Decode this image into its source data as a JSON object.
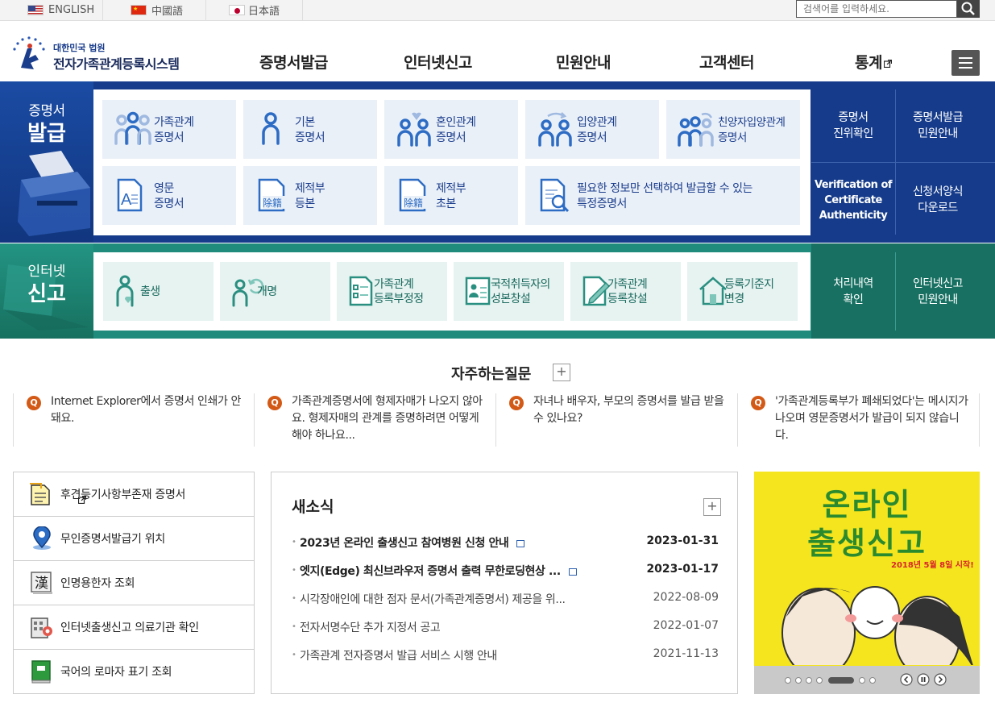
{
  "lang_bar": {
    "english": "ENGLISH",
    "chinese": "中國語",
    "japanese": "日本語",
    "search_placeholder": "검색어를 입력하세요."
  },
  "header": {
    "logo_line1": "대한민국 법원",
    "logo_line2": "전자가족관계등록시스템",
    "nav": [
      "증명서발급",
      "인터넷신고",
      "민원안내",
      "고객센터",
      "통계"
    ]
  },
  "issuance": {
    "section_small": "증명서",
    "section_big": "발급",
    "cards": [
      {
        "l1": "가족관계",
        "l2": "증명서"
      },
      {
        "l1": "기본",
        "l2": "증명서"
      },
      {
        "l1": "혼인관계",
        "l2": "증명서"
      },
      {
        "l1": "입양관계",
        "l2": "증명서"
      },
      {
        "l1": "친양자입양관계",
        "l2": "증명서"
      },
      {
        "l1": "영문",
        "l2": "증명서"
      },
      {
        "l1": "제적부",
        "l2": "등본"
      },
      {
        "l1": "제적부",
        "l2": "초본"
      },
      {
        "l1": "필요한 정보만 선택하여 발급할 수 있는",
        "l2": "특정증명서"
      }
    ],
    "icon_text_a": "A",
    "icon_text_jejeok": "除籍",
    "side_links": [
      {
        "l1": "증명서",
        "l2": "진위확인"
      },
      {
        "l1": "증명서발급",
        "l2": "민원안내"
      },
      {
        "l1": "Verification of",
        "l2": "Certificate",
        "l3": "Authenticity"
      },
      {
        "l1": "신청서양식",
        "l2": "다운로드"
      }
    ]
  },
  "report": {
    "section_small": "인터넷",
    "section_big": "신고",
    "cards": [
      {
        "l1": "출생",
        "l2": ""
      },
      {
        "l1": "개명",
        "l2": ""
      },
      {
        "l1": "가족관계",
        "l2": "등록부정정"
      },
      {
        "l1": "국적취득자의",
        "l2": "성본창설"
      },
      {
        "l1": "가족관계",
        "l2": "등록창설"
      },
      {
        "l1": "등록기준지",
        "l2": "변경"
      }
    ],
    "side_links": [
      {
        "l1": "처리내역",
        "l2": "확인"
      },
      {
        "l1": "인터넷신고",
        "l2": "민원안내"
      }
    ]
  },
  "faq": {
    "title": "자주하는질문",
    "more": "+",
    "q_mark": "Q",
    "items": [
      "Internet Explorer에서 증명서 인쇄가 안돼요.",
      "가족관계증명서에 형제자매가 나오지 않아요. 형제자매의 관계를 증명하려면 어떻게 해야 하나요...",
      "자녀나 배우자, 부모의 증명서를 발급 받을 수 있나요?",
      "'가족관계등록부가 폐쇄되었다'는 메시지가 나오며 영문증명서가 발급이 되지 않습니다."
    ]
  },
  "quick_links": [
    "후견등기사항부존재 증명서",
    "무인증명서발급기 위치",
    "인명용한자 조회",
    "인터넷출생신고 의료기관 확인",
    "국어의 로마자 표기 조회"
  ],
  "quick_icon_text": "漢",
  "news": {
    "title": "새소식",
    "more": "+",
    "items": [
      {
        "title": "2023년 온라인 출생신고 참여병원 신청 안내",
        "date": "2023-01-31",
        "bold": true
      },
      {
        "title": "엣지(Edge) 최신브라우저 증명서 출력 무한로딩현상 ...",
        "date": "2023-01-17",
        "bold": true
      },
      {
        "title": "시각장애인에 대한 점자 문서(가족관계증명서) 제공을 위...",
        "date": "2022-08-09",
        "bold": false
      },
      {
        "title": "전자서명수단 추가 지정서 공고",
        "date": "2022-01-07",
        "bold": false
      },
      {
        "title": "가족관계 전자증명서 발급 서비스 시행 안내",
        "date": "2021-11-13",
        "bold": false
      }
    ]
  },
  "banner": {
    "line1": "온라인",
    "line2": "출생신고",
    "sub": "2018년 5월 8일 시작!",
    "active_slide": 5,
    "slide_count": 7
  },
  "colors": {
    "issue_blue": "#153b8a",
    "report_teal": "#1f8b7c",
    "faq_q": "#d35a16",
    "banner_yellow": "#f4e51e"
  }
}
